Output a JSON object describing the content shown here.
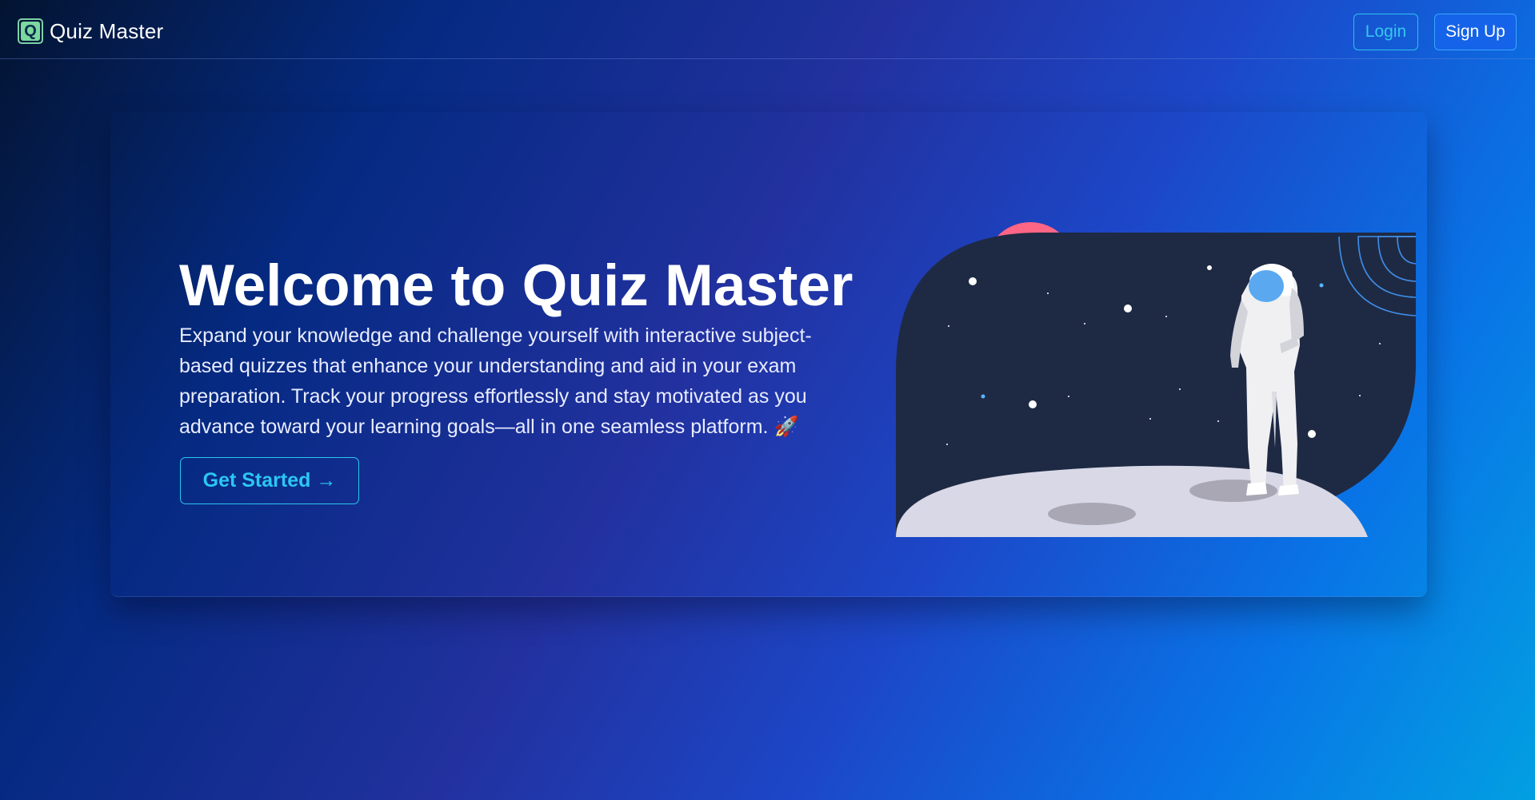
{
  "navbar": {
    "brand_letter": "Q",
    "brand_name": "Quiz Master",
    "login_label": "Login",
    "signup_label": "Sign Up"
  },
  "hero": {
    "title": "Welcome to Quiz Master",
    "description": "Expand your knowledge and challenge yourself with interactive subject-based quizzes that enhance your understanding and aid in your exam preparation. Track your progress effortlessly and stay motivated as you advance toward your learning goals—all in one seamless platform. 🚀",
    "cta_label": "Get Started →"
  },
  "illustration": {
    "subject": "astronaut-on-moon"
  },
  "colors": {
    "accent_cyan": "#2bc7f2",
    "signup_blue": "#1563e8",
    "logo_green": "#7bd89e",
    "planet_pink": "#ff6584",
    "space_navy": "#1e2a44"
  }
}
